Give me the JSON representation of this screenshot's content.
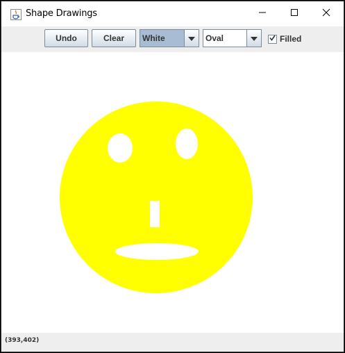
{
  "window": {
    "title": "Shape Drawings",
    "controls": {
      "minimize_icon": "minimize-icon",
      "maximize_icon": "maximize-icon",
      "close_icon": "close-icon"
    }
  },
  "toolbar": {
    "undo_label": "Undo",
    "clear_label": "Clear",
    "color_select": {
      "selected": "White",
      "highlight": "#a8bcd4"
    },
    "shape_select": {
      "selected": "Oval"
    },
    "filled_checkbox": {
      "label": "Filled",
      "checked": true
    }
  },
  "canvas": {
    "background": "#ffffff",
    "fill_color": "#ffff00",
    "inner_color": "#ffffff"
  },
  "status": {
    "coordinates": "(393,402)"
  }
}
